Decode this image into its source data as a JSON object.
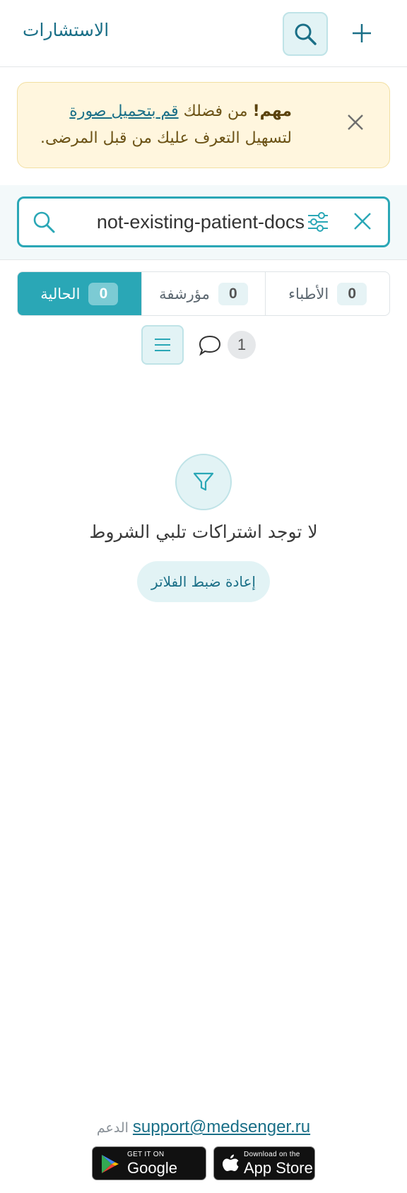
{
  "header": {
    "title": "الاستشارات",
    "search_icon": "search-icon",
    "add_icon": "plus-icon"
  },
  "alert": {
    "strong": "مهم!",
    "text_before_link": " من فضلك ",
    "link_text": "قم بتحميل صورة",
    "text_after_link": " لتسهيل التعرف عليك من قبل المرضى.",
    "close_icon": "close-icon"
  },
  "search": {
    "value": "not-existing-patient-docs",
    "icon": "search-icon",
    "filter_icon": "sliders-icon",
    "clear_icon": "close-icon"
  },
  "tabs": [
    {
      "label": "الحالية",
      "count": "0",
      "active": true
    },
    {
      "label": "مؤرشفة",
      "count": "0",
      "active": false
    },
    {
      "label": "الأطباء",
      "count": "0",
      "active": false
    }
  ],
  "toolbar": {
    "menu_icon": "menu-icon",
    "chat_icon": "chat-bubble-icon",
    "chat_count": "1"
  },
  "empty_state": {
    "icon": "filter-icon",
    "message": "لا توجد اشتراكات تلبي الشروط",
    "reset_label": "إعادة ضبط الفلاتر"
  },
  "footer": {
    "support_label": "الدعم",
    "support_email": "support@medsenger.ru",
    "google_play": {
      "small": "GET IT ON",
      "big": "Google Play"
    },
    "app_store": {
      "small": "Download on the",
      "big": "App Store"
    }
  },
  "colors": {
    "accent": "#2aa7b6",
    "accent_dark": "#1a6f87",
    "alert_bg": "#fff6de",
    "alert_border": "#f2dfa2"
  }
}
